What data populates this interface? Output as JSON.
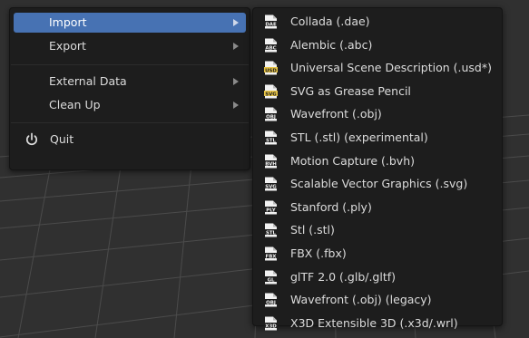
{
  "file_menu": {
    "items": [
      {
        "label": "Import",
        "has_submenu": true,
        "highlighted": true
      },
      {
        "label": "Export",
        "has_submenu": true
      },
      {
        "label": "External Data",
        "has_submenu": true
      },
      {
        "label": "Clean Up",
        "has_submenu": true
      },
      {
        "label": "Quit",
        "icon": "power-icon"
      }
    ]
  },
  "import_submenu": {
    "items": [
      {
        "label": "Collada (.dae)",
        "icon_text": "DAE"
      },
      {
        "label": "Alembic (.abc)",
        "icon_text": "ABC"
      },
      {
        "label": "Universal Scene Description (.usd*)",
        "icon_text": "USD"
      },
      {
        "label": "SVG as Grease Pencil",
        "icon_text": "SVG"
      },
      {
        "label": "Wavefront (.obj)",
        "icon_text": "OBJ"
      },
      {
        "label": "STL (.stl) (experimental)",
        "icon_text": "STL"
      },
      {
        "label": "Motion Capture (.bvh)",
        "icon_text": "BVH"
      },
      {
        "label": "Scalable Vector Graphics (.svg)",
        "icon_text": "SVG"
      },
      {
        "label": "Stanford (.ply)",
        "icon_text": "PLY"
      },
      {
        "label": "Stl (.stl)",
        "icon_text": "STL"
      },
      {
        "label": "FBX (.fbx)",
        "icon_text": "FBX"
      },
      {
        "label": "glTF 2.0 (.glb/.gltf)",
        "icon_text": "GL"
      },
      {
        "label": "Wavefront (.obj) (legacy)",
        "icon_text": "OBJ"
      },
      {
        "label": "X3D Extensible 3D (.x3d/.wrl)",
        "icon_text": "X3D"
      }
    ]
  },
  "colors": {
    "highlight": "#4772b3",
    "menu_bg": "#1d1d1d",
    "viewport_bg": "#303030",
    "grid_line": "#4a4a4a",
    "file_icon_badge_gold": "#e8c547"
  }
}
